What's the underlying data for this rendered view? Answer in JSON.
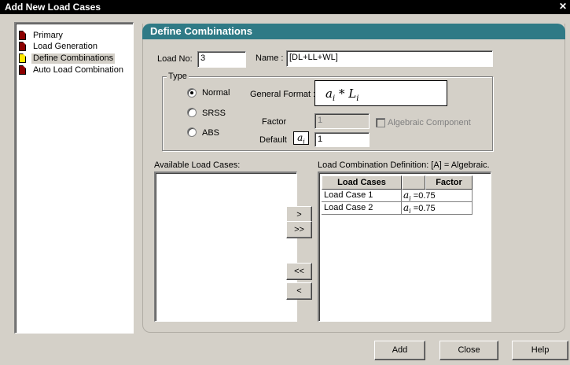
{
  "window": {
    "title": "Add New Load Cases",
    "close_glyph": "✕"
  },
  "tree": {
    "items": [
      {
        "label": "Primary",
        "selected": false
      },
      {
        "label": "Load Generation",
        "selected": false
      },
      {
        "label": "Define Combinations",
        "selected": true
      },
      {
        "label": "Auto Load Combination",
        "selected": false
      }
    ]
  },
  "panel": {
    "title": "Define Combinations"
  },
  "form": {
    "load_no_label": "Load No:",
    "load_no_value": "3",
    "name_label": "Name :",
    "name_value": "[DL+LL+WL]"
  },
  "type_group": {
    "legend": "Type",
    "options": [
      {
        "label": "Normal",
        "selected": true
      },
      {
        "label": "SRSS",
        "selected": false
      },
      {
        "label": "ABS",
        "selected": false
      }
    ],
    "general_format_label": "General Format :",
    "formula": {
      "a": "a",
      "sub": "i",
      "op": "* ",
      "L": "L",
      "sub2": "i"
    },
    "factor_label": "Factor",
    "factor_value": "1",
    "algebraic_label": "Algebraic Component",
    "default_label": "Default",
    "default_symbol": {
      "a": "a",
      "sub": "i"
    },
    "default_value": "1"
  },
  "available": {
    "label": "Available Load Cases:"
  },
  "transfer_buttons": [
    ">",
    ">>",
    "<<",
    "<"
  ],
  "combination": {
    "label": "Load Combination Definition:  [A] = Algebraic.",
    "headers": [
      "Load Cases",
      "",
      "Factor"
    ],
    "rows": [
      {
        "case": "Load Case 1",
        "a": "a",
        "sub": "i",
        "eq": " =",
        "factor": "0.75"
      },
      {
        "case": "Load Case 2",
        "a": "a",
        "sub": "i",
        "eq": " =",
        "factor": "0.75"
      }
    ]
  },
  "footer": {
    "add": "Add",
    "close": "Close",
    "help": "Help"
  }
}
